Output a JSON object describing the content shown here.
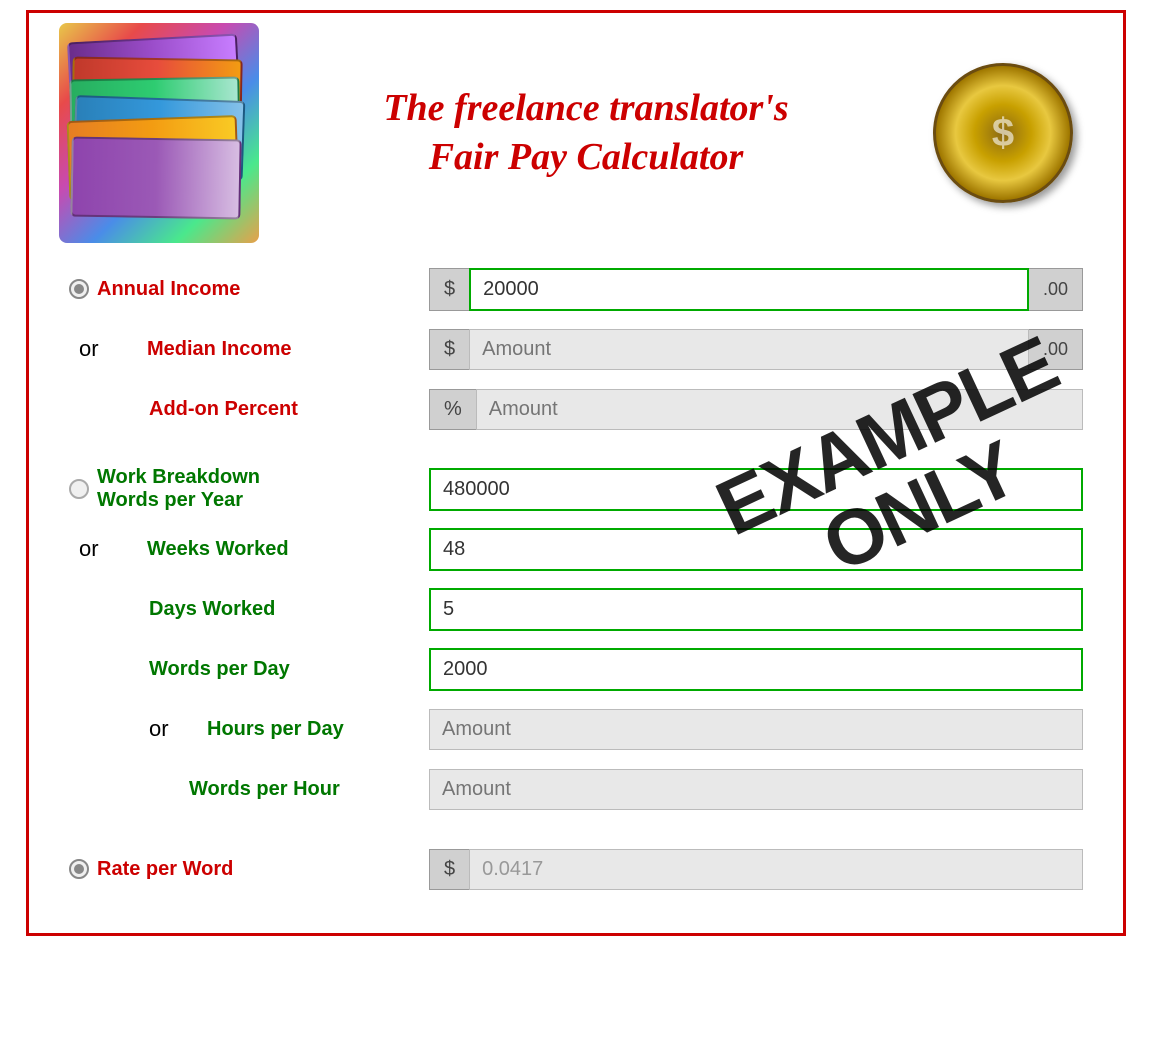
{
  "header": {
    "title_line1": "The freelance translator's",
    "title_line2": "Fair Pay Calculator"
  },
  "income_section": {
    "annual_income_label": "Annual Income",
    "annual_income_value": "20000",
    "annual_income_currency": "$",
    "annual_income_cents": ".00",
    "or_label_1": "or",
    "median_income_label": "Median Income",
    "median_income_currency": "$",
    "median_income_placeholder": "Amount",
    "median_income_cents": ".00",
    "addon_percent_label": "Add-on Percent",
    "addon_percent_symbol": "%",
    "addon_percent_placeholder": "Amount"
  },
  "work_section": {
    "work_breakdown_label": "Work Breakdown",
    "words_per_year_label": "Words per Year",
    "words_per_year_value": "480000",
    "or_label_2": "or",
    "weeks_worked_label": "Weeks Worked",
    "weeks_worked_value": "48",
    "days_worked_label": "Days Worked",
    "days_worked_value": "5",
    "words_per_day_label": "Words per Day",
    "words_per_day_value": "2000",
    "or_label_3": "or",
    "hours_per_day_label": "Hours per Day",
    "hours_per_day_placeholder": "Amount",
    "words_per_hour_label": "Words per Hour",
    "words_per_hour_placeholder": "Amount"
  },
  "rate_section": {
    "rate_per_word_label": "Rate per Word",
    "rate_currency": "$",
    "rate_value": "0.0417"
  },
  "stamp": {
    "line1": "EXAMPLE",
    "line2": "ONLY"
  }
}
